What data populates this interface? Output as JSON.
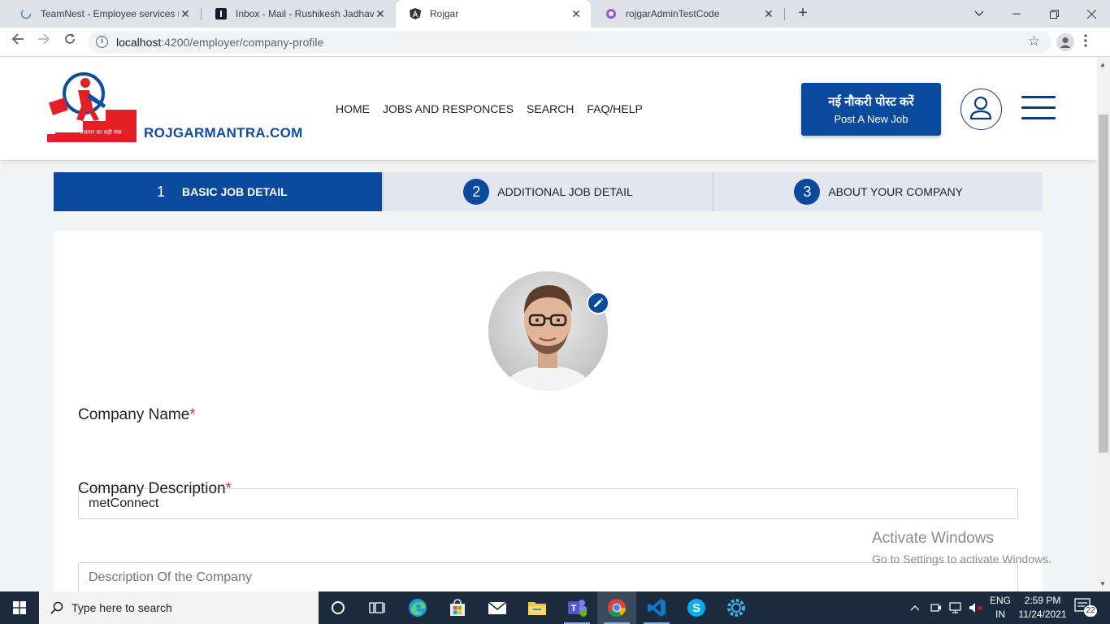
{
  "browser": {
    "tabs": [
      {
        "label": "TeamNest - Employee services m",
        "icon": "loading-spinner-icon",
        "active": false
      },
      {
        "label": "Inbox - Mail - Rushikesh Jadhav",
        "icon": "mail-app-icon",
        "active": false
      },
      {
        "label": "Rojgar",
        "icon": "angular-icon",
        "active": true
      },
      {
        "label": "rojgarAdminTestCode",
        "icon": "app-icon",
        "active": false
      }
    ],
    "close_glyph": "✕",
    "newtab_glyph": "+",
    "url_host": "localhost",
    "url_rest": ":4200/employer/company-profile"
  },
  "header": {
    "brand": "ROJGARMANTRA.COM",
    "logo_tagline": "रोजगार का सही मंत्रा",
    "nav": [
      "HOME",
      "JOBS AND RESPONCES",
      "SEARCH",
      "FAQ/HELP"
    ],
    "post_job_hindi": "नई नौकरी पोस्ट करें",
    "post_job_english": "Post A New Job"
  },
  "steps": [
    {
      "num": "1",
      "label": "BASIC JOB DETAIL",
      "active": true
    },
    {
      "num": "2",
      "label": "ADDITIONAL JOB DETAIL",
      "active": false
    },
    {
      "num": "3",
      "label": "ABOUT YOUR COMPANY",
      "active": false
    }
  ],
  "form": {
    "company_name_label": "Company Name",
    "company_name_value": "metConnect",
    "company_desc_label": "Company Description",
    "company_desc_placeholder": "Description Of the Company",
    "required_mark": "*"
  },
  "watermark": {
    "line1": "Activate Windows",
    "line2": "Go to Settings to activate Windows."
  },
  "taskbar": {
    "search_placeholder": "Type here to search",
    "lang_line1": "ENG",
    "lang_line2": "IN",
    "time": "2:59 PM",
    "date": "11/24/2021",
    "notification_count": "22"
  },
  "colors": {
    "primary": "#0a4a9e",
    "required": "#d32f2f"
  }
}
